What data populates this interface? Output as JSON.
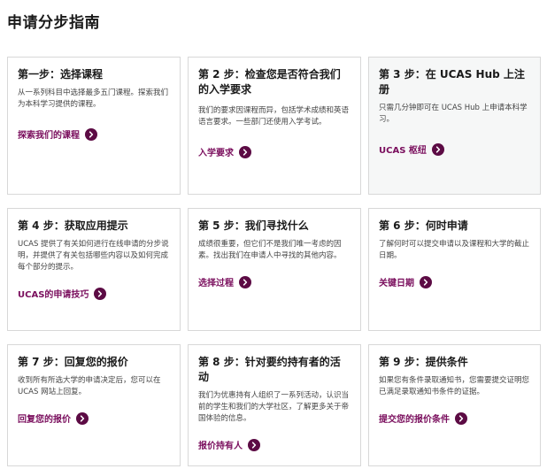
{
  "page": {
    "title": "申请分步指南"
  },
  "colors": {
    "link": "#7a0e5d",
    "arrow_bg": "#5c0b44"
  },
  "cards": [
    {
      "title": "第一步：选择课程",
      "desc": "从一系列科目中选择最多五门课程。探索我们为本科学习提供的课程。",
      "link": "探索我们的课程",
      "icon": "chevron-right-circle-icon"
    },
    {
      "title": "第 2 步：检查您是否符合我们的入学要求",
      "desc": "我们的要求因课程而异，包括学术成绩和英语语言要求。一些部门还使用入学考试。",
      "link": "入学要求",
      "icon": "chevron-right-circle-icon"
    },
    {
      "title": "第 3 步：在 UCAS Hub 上注册",
      "desc": "只需几分钟即可在 UCAS Hub 上申请本科学习。",
      "link": "UCAS 枢纽",
      "icon": "chevron-right-circle-icon"
    },
    {
      "title": "第 4 步：获取应用提示",
      "desc": "UCAS 提供了有关如何进行在线申请的分步说明，并提供了有关包括哪些内容以及如何完成每个部分的提示。",
      "link": "UCAS的申请技巧",
      "icon": "chevron-right-circle-icon"
    },
    {
      "title": "第 5 步：我们寻找什么",
      "desc": "成绩很重要，但它们不是我们唯一考虑的因素。找出我们在申请人中寻找的其他内容。",
      "link": "选择过程",
      "icon": "chevron-right-circle-icon"
    },
    {
      "title": "第 6 步：何时申请",
      "desc": "了解何时可以提交申请以及课程和大学的截止日期。",
      "link": "关键日期",
      "icon": "chevron-right-circle-icon"
    },
    {
      "title": "第 7 步：回复您的报价",
      "desc": "收到所有所选大学的申请决定后，您可以在 UCAS 网站上回复。",
      "link": "回复您的报价",
      "icon": "chevron-right-circle-icon"
    },
    {
      "title": "第 8 步：针对要约持有者的活动",
      "desc": "我们为优惠持有人组织了一系列活动，认识当前的学生和我们的大学社区，了解更多关于帝国体验的信息。",
      "link": "报价持有人",
      "icon": "chevron-right-circle-icon"
    },
    {
      "title": "第 9 步：提供条件",
      "desc": "如果您有条件录取通知书，您需要提交证明您已满足录取通知书条件的证据。",
      "link": "提交您的报价条件",
      "icon": "chevron-right-circle-icon"
    }
  ]
}
